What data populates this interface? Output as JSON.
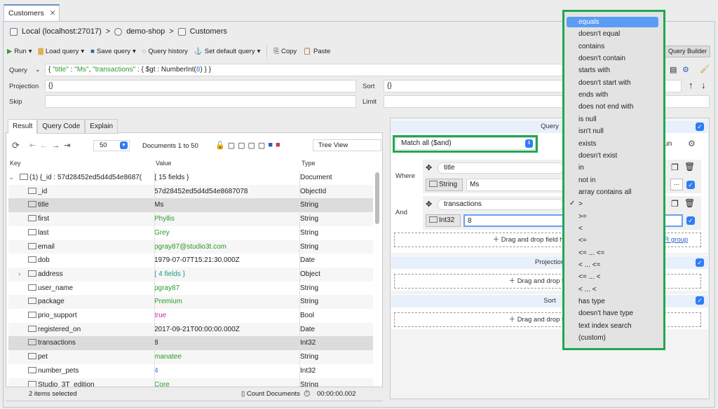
{
  "tab": {
    "title": "Customers",
    "close": "✕"
  },
  "breadcrumb": [
    "Local (localhost:27017)",
    "demo-shop",
    "Customers"
  ],
  "toolbar": {
    "run": "Run",
    "load": "Load query",
    "save": "Save query",
    "history": "Query history",
    "default": "Set default query",
    "copy": "Copy",
    "paste": "Paste",
    "query_builder": "Query Builder"
  },
  "query": {
    "label": "Query",
    "value_parts": [
      "{ ",
      "\"title\"",
      " : ",
      "\"Ms\"",
      ", ",
      "\"transactions\"",
      " : { $gt : NumberInt(",
      "8",
      ") } }"
    ],
    "projection_label": "Projection",
    "projection": "{}",
    "sort_label": "Sort",
    "sort": "{}",
    "skip_label": "Skip",
    "skip": "",
    "limit_label": "Limit",
    "limit": ""
  },
  "result_tabs": [
    "Result",
    "Query Code",
    "Explain"
  ],
  "result_toolbar": {
    "page_size": "50",
    "docs": "Documents 1 to 50",
    "view": "Tree View"
  },
  "table": {
    "headers": [
      "Key",
      "Value",
      "Type"
    ],
    "rows": [
      {
        "k": "(1) {_id : 57d28452ed5d4d54e8687(",
        "v": "{ 15 fields }",
        "t": "Document",
        "c": "",
        "exp": "open"
      },
      {
        "k": "_id",
        "v": "57d28452ed5d4d54e8687078",
        "t": "ObjectId",
        "c": ""
      },
      {
        "k": "title",
        "v": "Ms",
        "t": "String",
        "c": "",
        "sel": true
      },
      {
        "k": "first",
        "v": "Phyllis",
        "t": "String",
        "c": "g"
      },
      {
        "k": "last",
        "v": "Grey",
        "t": "String",
        "c": "g"
      },
      {
        "k": "email",
        "v": "pgray87@studio3t.com",
        "t": "String",
        "c": "g"
      },
      {
        "k": "dob",
        "v": "1979-07-07T15:21:30.000Z",
        "t": "Date",
        "c": ""
      },
      {
        "k": "address",
        "v": "{ 4 fields }",
        "t": "Object",
        "c": "tl",
        "exp": "closed"
      },
      {
        "k": "user_name",
        "v": "pgray87",
        "t": "String",
        "c": "g"
      },
      {
        "k": "package",
        "v": "Premium",
        "t": "String",
        "c": "g"
      },
      {
        "k": "prio_support",
        "v": "true",
        "t": "Bool",
        "c": "pk"
      },
      {
        "k": "registered_on",
        "v": "2017-09-21T00:00:00.000Z",
        "t": "Date",
        "c": ""
      },
      {
        "k": "transactions",
        "v": "8",
        "t": "Int32",
        "c": "",
        "sel": true
      },
      {
        "k": "pet",
        "v": "manatee",
        "t": "String",
        "c": "g"
      },
      {
        "k": "number_pets",
        "v": "4",
        "t": "Int32",
        "c": "bl"
      },
      {
        "k": "Studio_3T_edition",
        "v": "Core",
        "t": "String",
        "c": "g"
      }
    ]
  },
  "status": {
    "selected": "2 items selected",
    "count": "Count Documents",
    "time": "00:00:00.002"
  },
  "builder": {
    "query_title": "Query",
    "match": "Match all ($and)",
    "run": "Run",
    "where": "Where",
    "and": "And",
    "cond1": {
      "field": "title",
      "type": "String",
      "value": "Ms"
    },
    "cond2": {
      "field": "transactions",
      "type": "Int32",
      "value": "8"
    },
    "drop_field": "Drag and drop field here or double",
    "or_group": "OR group",
    "projection_title": "Projection",
    "sort_title": "Sort",
    "drop_fields": "Drag and drop fields he",
    "more": "..."
  },
  "operator_menu": {
    "selected": ">",
    "highlighted": "equals",
    "items": [
      "equals",
      "doesn't equal",
      "contains",
      "doesn't contain",
      "starts with",
      "doesn't start with",
      "ends with",
      "does not end with",
      "is null",
      "isn't null",
      "exists",
      "doesn't exist",
      "in",
      "not in",
      "array contains all",
      ">",
      ">=",
      "<",
      "<=",
      "<= ... <=",
      "< ... <=",
      "<= ... <",
      "< ... <",
      "has type",
      "doesn't have type",
      "text index search",
      "(custom)"
    ]
  },
  "colors": {
    "highlight": "#5b9cf5",
    "annotation_border": "#1fa84f",
    "checkbox": "#2f7cf6",
    "string_value": "#2a9a2a"
  }
}
